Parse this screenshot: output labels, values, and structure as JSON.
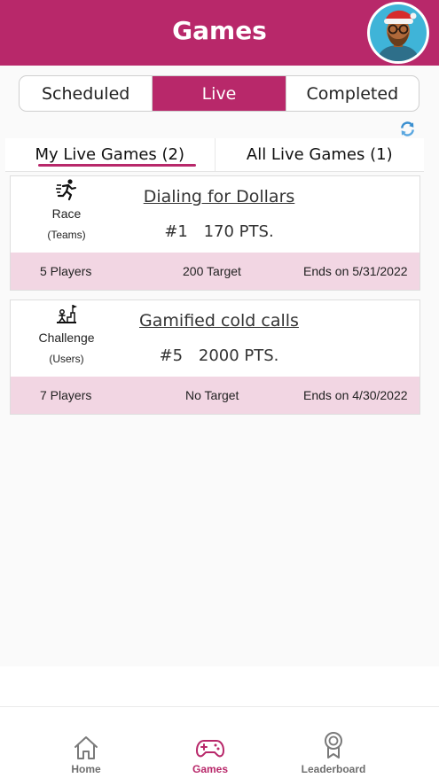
{
  "header": {
    "title": "Games"
  },
  "segments": [
    {
      "label": "Scheduled",
      "active": false
    },
    {
      "label": "Live",
      "active": true
    },
    {
      "label": "Completed",
      "active": false
    }
  ],
  "subtabs": [
    {
      "label": "My Live Games (2)",
      "active": true
    },
    {
      "label": "All Live Games (1)",
      "active": false
    }
  ],
  "games": [
    {
      "type": "Race",
      "type_sub": "(Teams)",
      "icon": "runner-icon",
      "title": "Dialing for Dollars",
      "rank": "#1",
      "points": "170 PTS.",
      "players": "5 Players",
      "target": "200 Target",
      "ends": "Ends on 5/31/2022"
    },
    {
      "type": "Challenge",
      "type_sub": "(Users)",
      "icon": "challenge-icon",
      "title": "Gamified cold calls",
      "rank": "#5",
      "points": "2000 PTS.",
      "players": "7 Players",
      "target": "No Target",
      "ends": "Ends on 4/30/2022"
    }
  ],
  "nav": [
    {
      "label": "Home",
      "icon": "home-icon",
      "active": false
    },
    {
      "label": "Games",
      "icon": "gamepad-icon",
      "active": true
    },
    {
      "label": "Leaderboard",
      "icon": "award-icon",
      "active": false
    }
  ],
  "colors": {
    "brand": "#b8286a",
    "card_footer": "#f2d6e3",
    "inactive_nav": "#6e6e6e"
  }
}
